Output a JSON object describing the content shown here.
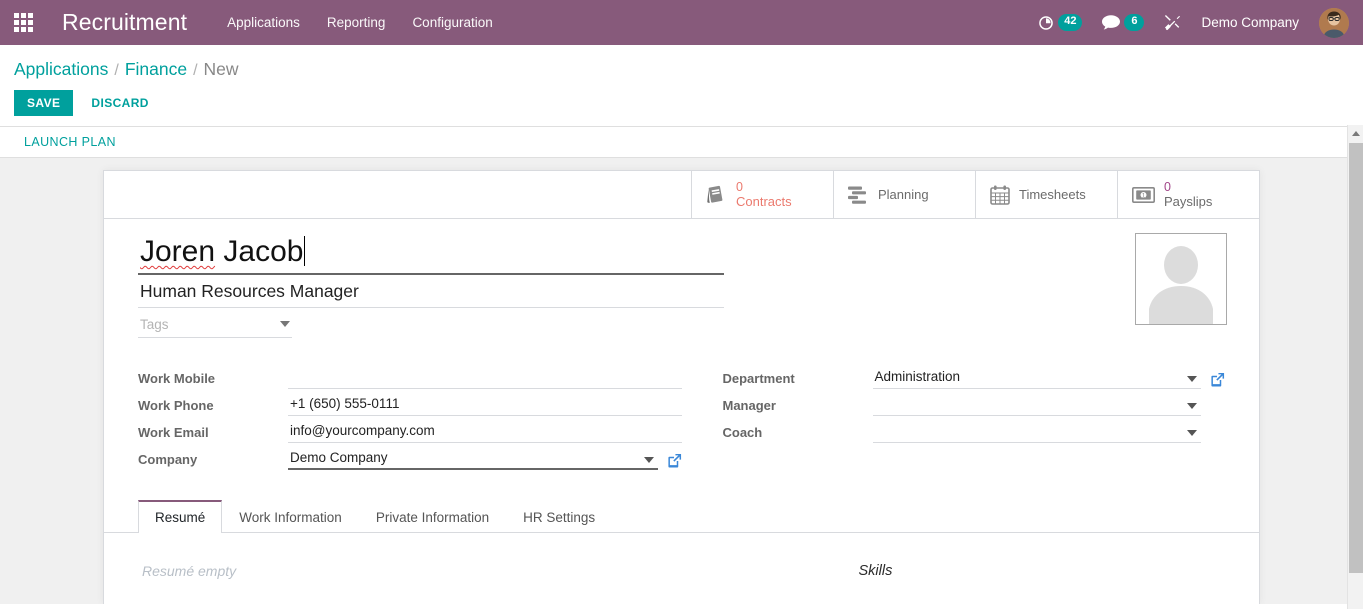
{
  "navbar": {
    "apps_icon": "grid-apps-icon",
    "brand": "Recruitment",
    "menu": [
      {
        "label": "Applications"
      },
      {
        "label": "Reporting"
      },
      {
        "label": "Configuration"
      }
    ],
    "activities": {
      "icon": "clock-icon",
      "count": "42"
    },
    "messages": {
      "icon": "chat-bubble-icon",
      "count": "6"
    },
    "debug": {
      "icon": "tools-icon"
    },
    "company": "Demo Company",
    "avatar": "user-avatar"
  },
  "control_panel": {
    "breadcrumb": {
      "root": "Applications",
      "parent": "Finance",
      "current": "New",
      "separator": "/"
    },
    "save_label": "SAVE",
    "discard_label": "DISCARD",
    "launch_plan_label": "LAUNCH PLAN"
  },
  "smart_buttons": [
    {
      "icon": "book-icon",
      "value": "0",
      "label": "Contracts"
    },
    {
      "icon": "gantt-icon",
      "value": "",
      "label": "Planning"
    },
    {
      "icon": "calendar-icon",
      "value": "",
      "label": "Timesheets"
    },
    {
      "icon": "money-icon",
      "value": "0",
      "label": "Payslips"
    }
  ],
  "record": {
    "name": "Joren Jacob",
    "name_spell_error_word": "Joren",
    "name_rest": " Jacob",
    "job_title": "Human Resources Manager",
    "tags_placeholder": "Tags",
    "avatar_icon": "person-placeholder-icon"
  },
  "fields_left": [
    {
      "label": "Work Mobile",
      "value": "",
      "type": "text"
    },
    {
      "label": "Work Phone",
      "value": "+1 (650) 555-0111",
      "type": "text"
    },
    {
      "label": "Work Email",
      "value": "info@yourcompany.com",
      "type": "text"
    },
    {
      "label": "Company",
      "value": "Demo Company",
      "type": "many2one"
    }
  ],
  "fields_right": [
    {
      "label": "Department",
      "value": "Administration",
      "type": "many2one"
    },
    {
      "label": "Manager",
      "value": "",
      "type": "many2one"
    },
    {
      "label": "Coach",
      "value": "",
      "type": "many2one"
    }
  ],
  "notebook": {
    "tabs": [
      {
        "label": "Resumé",
        "active": true
      },
      {
        "label": "Work Information",
        "active": false
      },
      {
        "label": "Private Information",
        "active": false
      },
      {
        "label": "HR Settings",
        "active": false
      }
    ],
    "resume_empty_text": "Resumé empty",
    "skills_title": "Skills"
  },
  "colors": {
    "brand_purple": "#875A7B",
    "accent_teal": "#00A09D",
    "contracts_red": "#eb7a6e",
    "payslips_purple": "#a24689",
    "link_blue": "#3a87d8"
  }
}
